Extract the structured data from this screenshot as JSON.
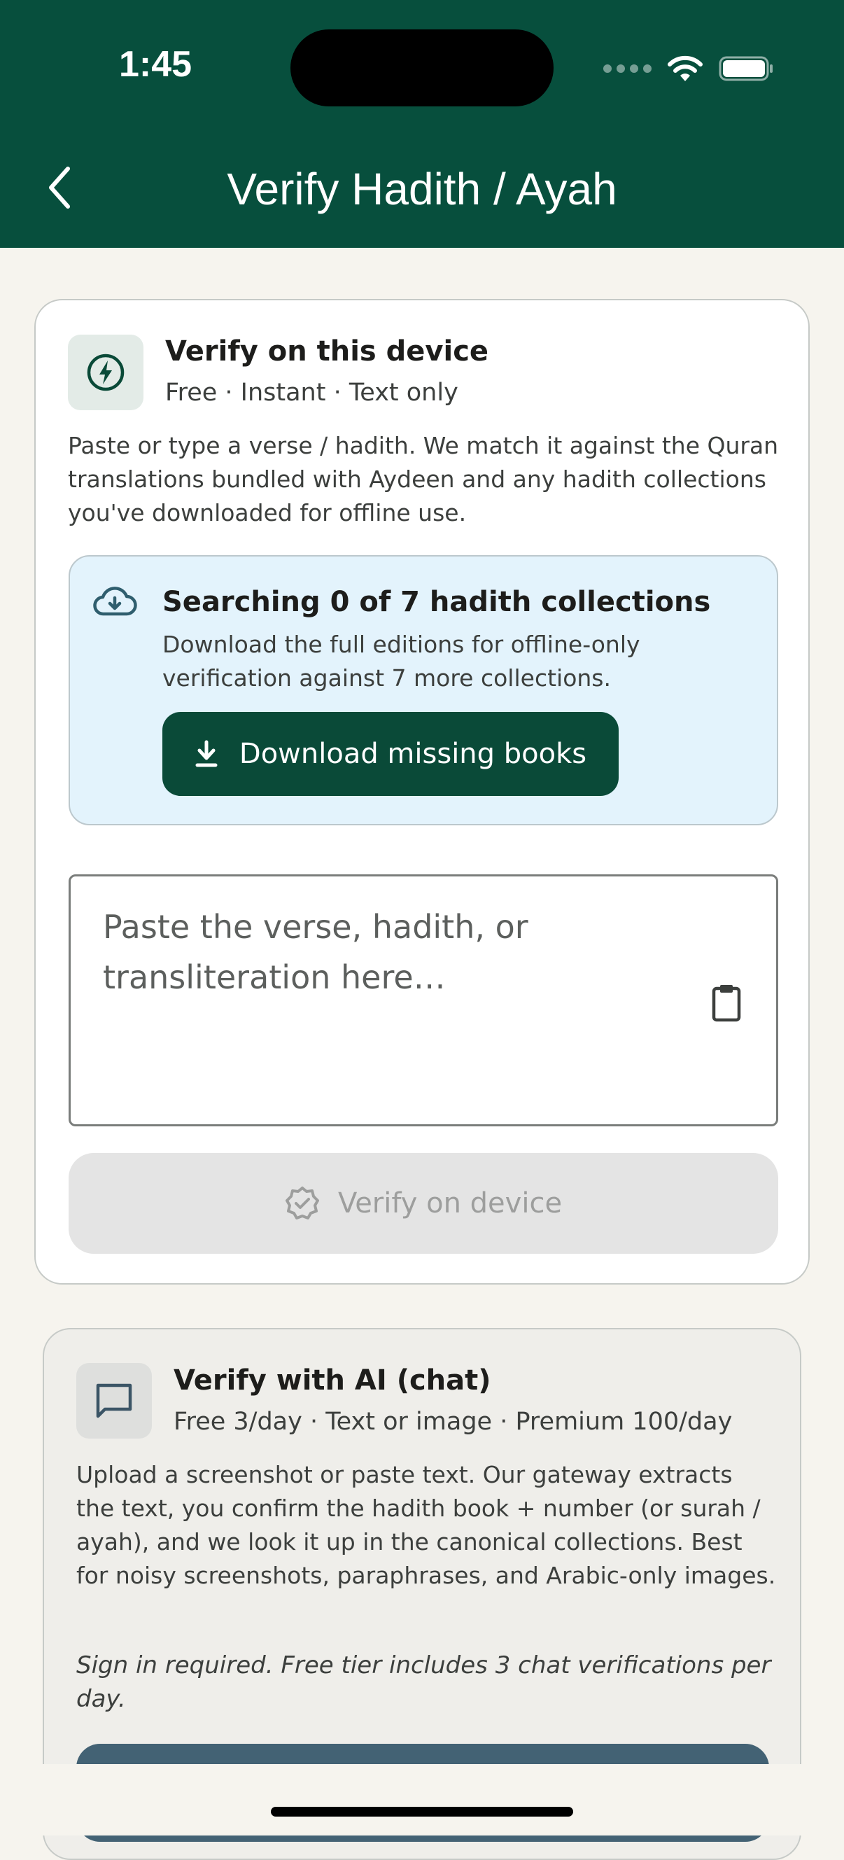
{
  "status_bar": {
    "time": "1:45"
  },
  "header": {
    "title": "Verify Hadith / Ayah",
    "background_color": "#074f3d"
  },
  "device_card": {
    "icon": "bolt-circle-icon",
    "title": "Verify on this device",
    "subtitle": "Free · Instant · Text only",
    "description": "Paste or type a verse / hadith. We match it against the Quran translations bundled with Aydeen and any hadith collections you've downloaded for offline use.",
    "collections_notice": {
      "icon": "cloud-download-icon",
      "title": "Searching 0 of 7 hadith collections",
      "description": "Download the full editions for offline-only verification against 7 more collections.",
      "button_label": "Download missing books",
      "button_icon": "download-icon"
    },
    "input": {
      "placeholder": "Paste the verse, hadith, or transliteration here…",
      "value": "",
      "paste_icon": "clipboard-icon"
    },
    "verify_button": {
      "label": "Verify on device",
      "icon": "verified-badge-icon",
      "enabled": false
    }
  },
  "ai_card": {
    "icon": "chat-bubble-icon",
    "title": "Verify with AI (chat)",
    "subtitle": "Free 3/day · Text or image · Premium 100/day",
    "description": "Upload a screenshot or paste text. Our gateway extracts the text, you confirm the hadith book + number (or surah / ayah), and we look it up in the canonical collections. Best for noisy screenshots, paraphrases, and Arabic-only images.",
    "note": "Sign in required. Free tier includes 3 chat verifications per day."
  },
  "colors": {
    "primary": "#074f3d",
    "button_dark": "#0a4a38",
    "info_bg": "#e3f3fc",
    "ai_cta": "#436274",
    "page_bg": "#f6f4ee"
  }
}
